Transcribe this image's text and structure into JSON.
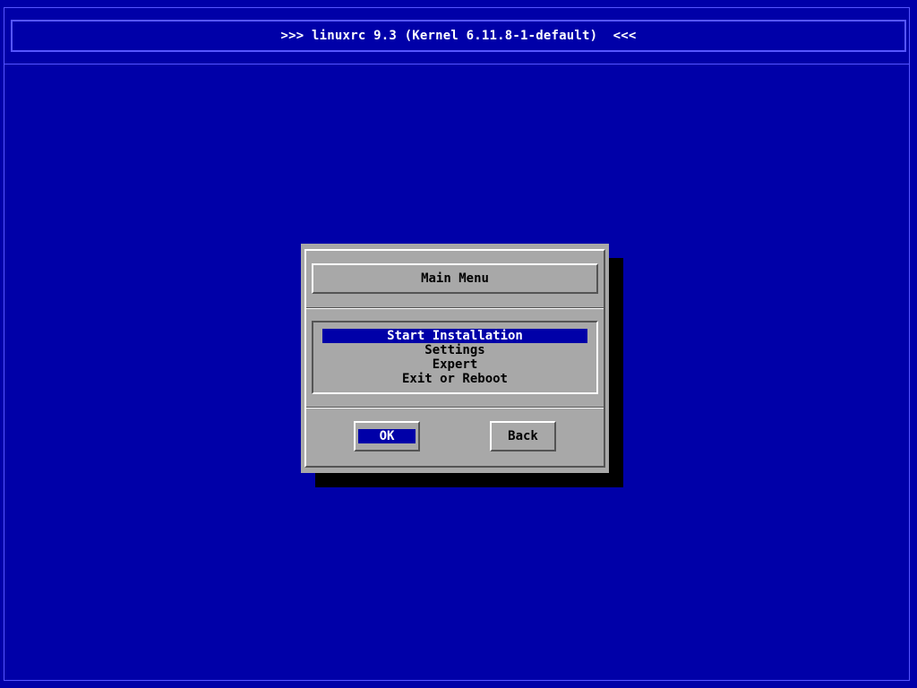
{
  "header": {
    "title": ">>> linuxrc 9.3 (Kernel 6.11.8-1-default)  <<<"
  },
  "dialog": {
    "title": "Main Menu",
    "menu_items": [
      {
        "label": "Start Installation",
        "selected": true
      },
      {
        "label": "Settings",
        "selected": false
      },
      {
        "label": "Expert",
        "selected": false
      },
      {
        "label": "Exit or Reboot",
        "selected": false
      }
    ],
    "ok_label": "OK",
    "back_label": "Back"
  },
  "colors": {
    "background": "#0000a8",
    "dialog": "#a8a8a8",
    "highlight": "#0000a8",
    "frame_line": "#5656ff"
  }
}
